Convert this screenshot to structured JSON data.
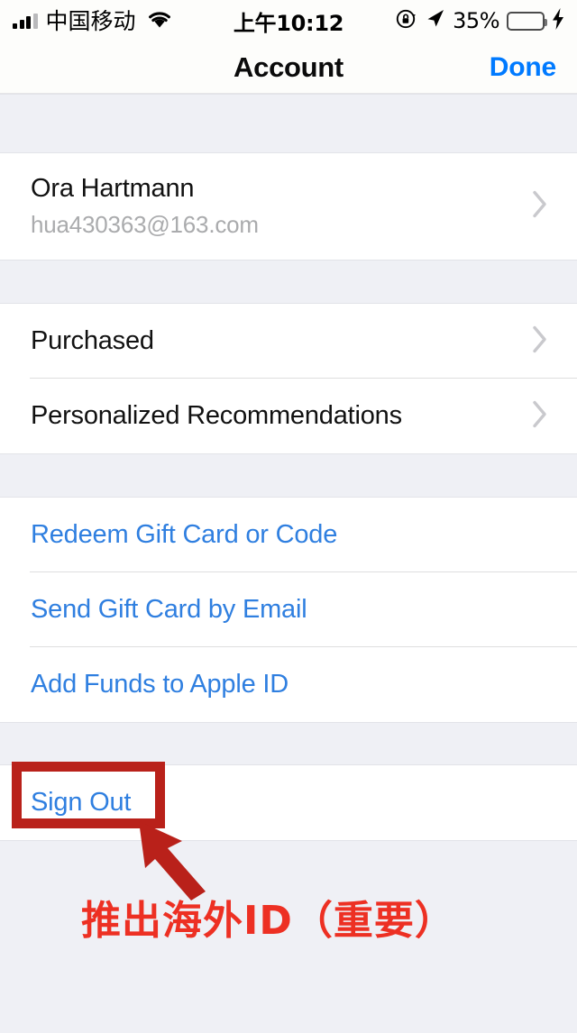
{
  "status_bar": {
    "carrier": "中国移动",
    "time": "上午10:12",
    "battery_percent": "35%",
    "battery_level": 35,
    "battery_charging": true,
    "signal_bars_filled": 3,
    "signal_bars_total": 4,
    "icons": [
      "signal-bars-icon",
      "wifi-icon",
      "rotation-lock-icon",
      "location-arrow-icon",
      "battery-icon",
      "charging-bolt-icon"
    ]
  },
  "nav": {
    "title": "Account",
    "done_label": "Done"
  },
  "account_section": {
    "name": "Ora Hartmann",
    "email": "hua430363@163.com"
  },
  "menu_section": {
    "items": [
      {
        "label": "Purchased"
      },
      {
        "label": "Personalized Recommendations"
      }
    ]
  },
  "actions_section": {
    "items": [
      {
        "label": "Redeem Gift Card or Code"
      },
      {
        "label": "Send Gift Card by Email"
      },
      {
        "label": "Add Funds to Apple ID"
      }
    ]
  },
  "signout_section": {
    "label": "Sign Out"
  },
  "annotation": {
    "text": "推出海外ID（重要）",
    "highlight_color": "#b9211a",
    "text_color": "#ed3023"
  },
  "colors": {
    "accent_blue": "#007aff",
    "link_blue": "#2f7fe0",
    "group_background": "#eff0f5",
    "row_background": "#ffffff",
    "battery_green": "#4cd464"
  }
}
